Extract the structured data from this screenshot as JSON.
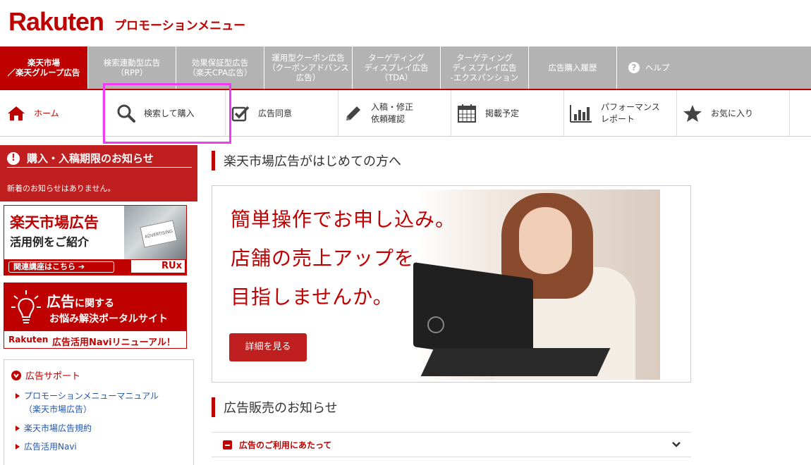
{
  "header": {
    "logo": "Rakuten",
    "subtitle": "プロモーションメニュー"
  },
  "topnav": [
    {
      "label": "楽天市場\n／楽天グループ広告",
      "active": true
    },
    {
      "label": "検索連動型広告\n（RPP）"
    },
    {
      "label": "効果保証型広告\n（楽天CPA広告）"
    },
    {
      "label": "運用型クーポン広告\n（クーポンアドバンス\n広告）"
    },
    {
      "label": "ターゲティング\nディスプレイ広告\n（TDA）"
    },
    {
      "label": "ターゲティング\nディスプレイ広告\n-エクスパンション"
    },
    {
      "label": "広告購入履歴"
    },
    {
      "label": "ヘルプ",
      "icon": "help-icon"
    }
  ],
  "subnav": [
    {
      "label": "ホーム",
      "icon": "home-icon"
    },
    {
      "label": "検索して購入",
      "icon": "search-icon"
    },
    {
      "label": "広告同意",
      "icon": "checkbox-icon"
    },
    {
      "label": "入稿・修正\n依頼確認",
      "icon": "pencil-icon"
    },
    {
      "label": "掲載予定",
      "icon": "calendar-icon"
    },
    {
      "label": "パフォーマンス\nレポート",
      "icon": "bar-chart-icon"
    },
    {
      "label": "お気に入り",
      "icon": "star-icon"
    }
  ],
  "sidebar": {
    "notice_title": "購入・入稿期限のお知らせ",
    "notice_body": "新着のお知らせはありません。",
    "banner1": {
      "title": "楽天市場広告",
      "subtitle": "活用例をご紹介",
      "cta": "関連講座はこちら ➔",
      "card_text": "ADVERTISING",
      "brand": "RUx"
    },
    "banner2": {
      "line1_big": "広告",
      "line1_small": "に関する",
      "line2": "お悩み解決ポータルサイト",
      "brand": "Rakuten",
      "line3": "広告活用Naviリニューアル！"
    },
    "support_title": "広告サポート",
    "support_links": [
      "プロモーションメニューマニュアル\n（楽天市場広告）",
      "楽天市場広告規約",
      "広告活用Navi"
    ]
  },
  "main": {
    "section1_title": "楽天市場広告がはじめての方へ",
    "hero_lines": [
      "簡単操作でお申し込み。",
      "店舗の売上アップを",
      "目指しませんか。"
    ],
    "hero_button": "詳細を見る",
    "section2_title": "広告販売のお知らせ",
    "accordion_label": "広告のご利用にあたって"
  },
  "colors": {
    "brand_red": "#bf0000",
    "nav_gray": "#b3b3b3",
    "highlight": "#f03cf0",
    "link_blue": "#2255aa"
  }
}
